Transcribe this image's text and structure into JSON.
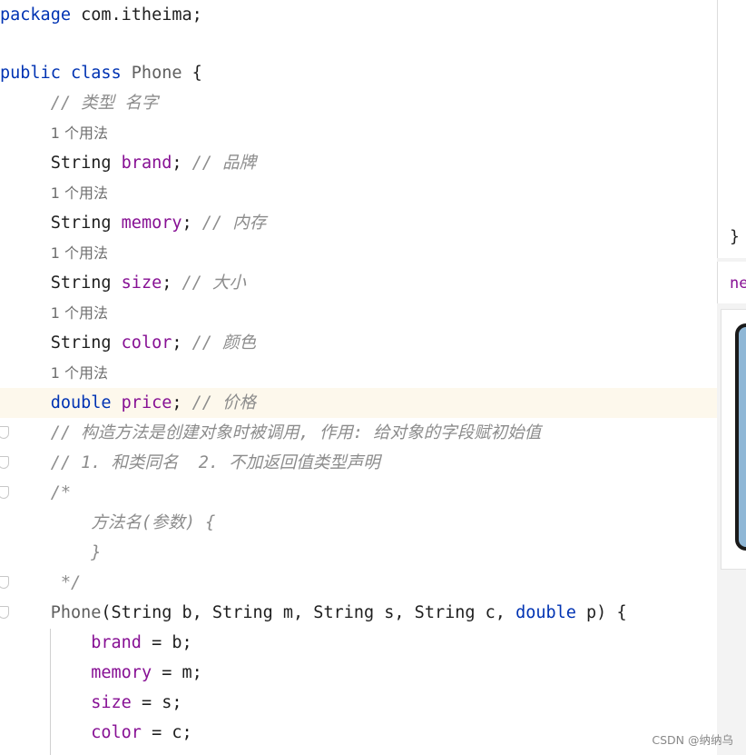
{
  "code": {
    "package_kw": "package",
    "package_name": " com.itheima;",
    "class_mods": "public class",
    "class_name": "Phone",
    "class_open": " {",
    "comment_type_name": "// 类型 名字",
    "usage_hint": "1 个用法",
    "field_type_string": "String",
    "field_type_double": "double",
    "field_brand": "brand",
    "field_memory": "memory",
    "field_size": "size",
    "field_color": "color",
    "field_price": "price",
    "semicolon": ";",
    "cmt_brand": "// 品牌",
    "cmt_memory": "// 内存",
    "cmt_size": "// 大小",
    "cmt_color": "// 颜色",
    "cmt_price": "// 价格",
    "cmt_ctor_desc": "// 构造方法是创建对象时被调用, 作用: 给对象的字段赋初始值",
    "cmt_ctor_rules": "// 1. 和类同名  2. 不加返回值类型声明",
    "block_open": "/*",
    "block_sig": "方法名(参数) {",
    "block_brace": "}",
    "block_close": "*/",
    "ctor_name": "Phone",
    "ctor_params_1": "(String b, String m, String s, String c, ",
    "ctor_param_kw": "double",
    "ctor_params_2": " p) {",
    "assign_brand_rhs": " = b;",
    "assign_memory_rhs": " = m;",
    "assign_size_rhs": " = s;",
    "assign_color_rhs": " = c;"
  },
  "side": {
    "brace": "}",
    "tab_label": "ne"
  },
  "watermark": "CSDN @纳纳乌"
}
